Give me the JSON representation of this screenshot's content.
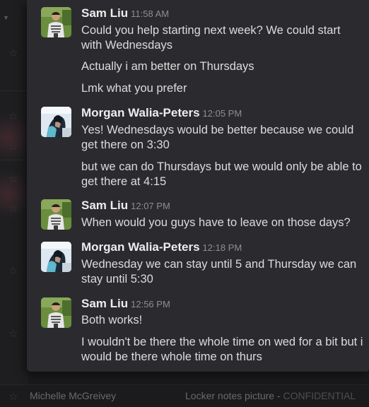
{
  "background": {
    "footer": {
      "name": "Michelle McGreivey",
      "file_name": "Locker notes picture",
      "file_separator": " - ",
      "file_label": "CONFIDENTIAL"
    }
  },
  "messages": [
    {
      "author": "Sam Liu",
      "time": "11:58 AM",
      "lines": [
        "Could you help starting next week? We could start with Wednesdays",
        "Actually i am better on Thursdays",
        "Lmk what you prefer"
      ]
    },
    {
      "author": "Morgan Walia-Peters",
      "time": "12:05 PM",
      "lines": [
        "Yes! Wednesdays would be better because we could get there on 3:30",
        "but we can do Thursdays but we would only be able to get there at 4:15"
      ]
    },
    {
      "author": "Sam Liu",
      "time": "12:07 PM",
      "lines": [
        "When would you guys have to leave on those days?"
      ]
    },
    {
      "author": "Morgan Walia-Peters",
      "time": "12:18 PM",
      "lines": [
        "Wednesday we can stay until 5 and Thursday we can stay until 5:30"
      ]
    },
    {
      "author": "Sam Liu",
      "time": "12:56 PM",
      "lines": [
        "Both works!",
        "I wouldn't be there the whole time on wed for a bit but i would be there whole time on thurs"
      ]
    }
  ]
}
